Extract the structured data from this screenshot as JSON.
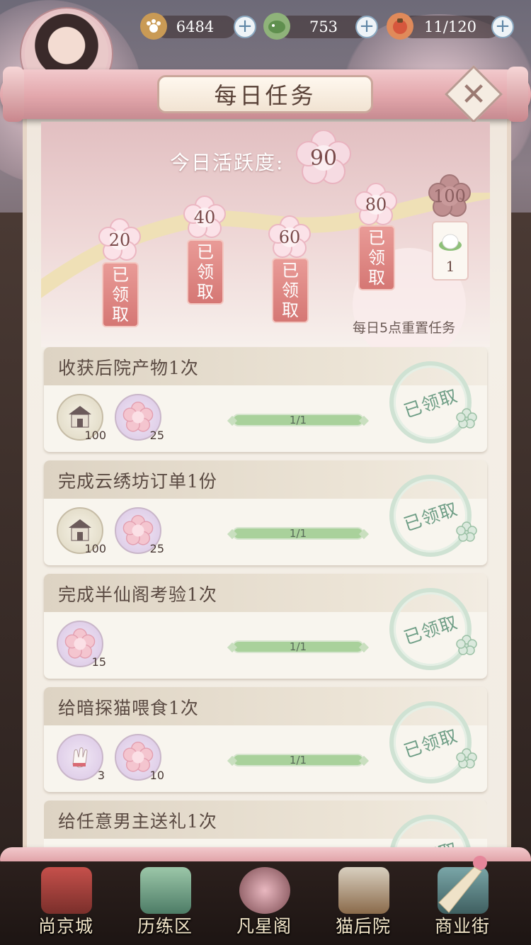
{
  "currencies": [
    {
      "icon": "paw-coin-icon",
      "value": "6484"
    },
    {
      "icon": "jade-gem-icon",
      "value": "753"
    },
    {
      "icon": "stamina-food-icon",
      "value": "11/120"
    }
  ],
  "panel": {
    "title": "每日任务",
    "activity_label": "今日活跃度:",
    "activity_value": "90",
    "reset_note": "每日5点重置任务"
  },
  "milestones": [
    {
      "points": "20",
      "status": [
        "已",
        "领",
        "取"
      ]
    },
    {
      "points": "40",
      "status": [
        "已",
        "领",
        "取"
      ]
    },
    {
      "points": "60",
      "status": [
        "已",
        "领",
        "取"
      ]
    },
    {
      "points": "80",
      "status": [
        "已",
        "领",
        "取"
      ]
    },
    {
      "points": "100",
      "reward_icon": "rice-cake-icon",
      "reward_count": "1"
    }
  ],
  "tasks": [
    {
      "title": "收获后院产物1次",
      "rewards": [
        {
          "icon": "house-icon",
          "count": "100"
        },
        {
          "icon": "blossom-icon",
          "count": "25"
        }
      ],
      "progress_text": "1/1",
      "progress": 1.0,
      "status": "已领取"
    },
    {
      "title": "完成云绣坊订单1份",
      "rewards": [
        {
          "icon": "house-icon",
          "count": "100"
        },
        {
          "icon": "blossom-icon",
          "count": "25"
        }
      ],
      "progress_text": "1/1",
      "progress": 1.0,
      "status": "已领取"
    },
    {
      "title": "完成半仙阁考验1次",
      "rewards": [
        {
          "icon": "blossom-icon",
          "count": "15"
        }
      ],
      "progress_text": "1/1",
      "progress": 1.0,
      "status": "已领取"
    },
    {
      "title": "给暗探猫喂食1次",
      "rewards": [
        {
          "icon": "glove-icon",
          "count": "3"
        },
        {
          "icon": "blossom-icon",
          "count": "10"
        }
      ],
      "progress_text": "1/1",
      "progress": 1.0,
      "status": "已领取"
    },
    {
      "title": "给任意男主送礼1次",
      "status": "已领取"
    }
  ],
  "nav": [
    {
      "label": "尚京城",
      "icon": "city-gate-icon"
    },
    {
      "label": "历练区",
      "icon": "mountain-icon"
    },
    {
      "label": "凡星阁",
      "icon": "cherry-tree-icon"
    },
    {
      "label": "猫后院",
      "icon": "cat-basket-icon"
    },
    {
      "label": "商业街",
      "icon": "shop-street-icon"
    }
  ],
  "colors": {
    "accent_pink": "#d57774",
    "claimed_green": "#6f9e86",
    "progress_green": "#a9d19b",
    "scroll_pink": "#e2a6ab"
  }
}
